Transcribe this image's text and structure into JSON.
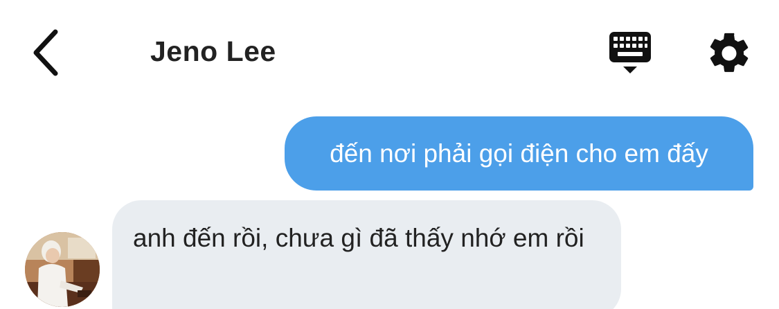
{
  "header": {
    "title": "Jeno Lee",
    "back_icon": "chevron-left-icon",
    "keyboard_icon": "keyboard-icon",
    "settings_icon": "gear-icon"
  },
  "messages": [
    {
      "direction": "outgoing",
      "text": "đến nơi phải gọi điện cho em đấy"
    },
    {
      "direction": "incoming",
      "text": "anh đến rồi, chưa gì đã thấy nhớ em rồi"
    }
  ],
  "colors": {
    "outgoing_bubble": "#4c9fe9",
    "incoming_bubble": "#e9edf1",
    "text": "#222222"
  }
}
